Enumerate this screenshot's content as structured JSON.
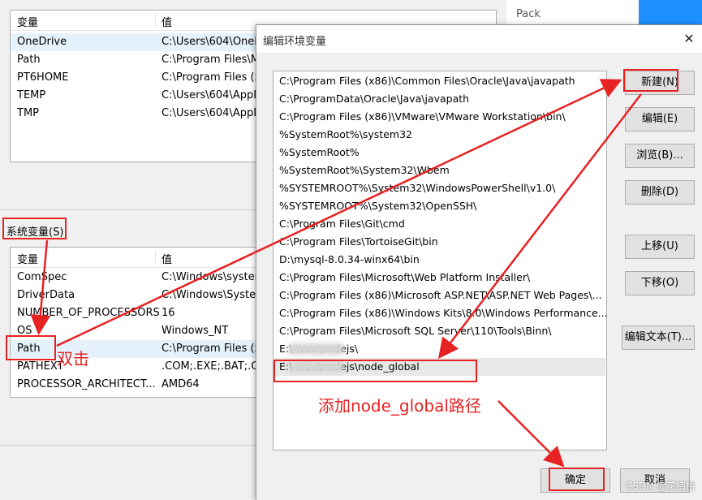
{
  "background_window": {
    "user_vars": {
      "headers": {
        "name": "变量",
        "value": "值"
      },
      "rows": [
        {
          "name": "OneDrive",
          "value": "C:\\Users\\604\\OneD"
        },
        {
          "name": "Path",
          "value": "C:\\Program Files\\M"
        },
        {
          "name": "PT6HOME",
          "value": "C:\\Program Files (x"
        },
        {
          "name": "TEMP",
          "value": "C:\\Users\\604\\AppD"
        },
        {
          "name": "TMP",
          "value": "C:\\Users\\604\\AppD"
        }
      ]
    },
    "system_vars_label": "系统变量(S)",
    "system_vars": {
      "headers": {
        "name": "变量",
        "value": "值"
      },
      "rows": [
        {
          "name": "ComSpec",
          "value": "C:\\Windows\\system"
        },
        {
          "name": "DriverData",
          "value": "C:\\Windows\\Syster"
        },
        {
          "name": "NUMBER_OF_PROCESSORS",
          "value": "16"
        },
        {
          "name": "OS",
          "value": "Windows_NT"
        },
        {
          "name": "Path",
          "value": "C:\\Program Files (x"
        },
        {
          "name": "PATHEXT",
          "value": ".COM;.EXE;.BAT;.CN"
        },
        {
          "name": "PROCESSOR_ARCHITECT...",
          "value": "AMD64"
        }
      ]
    },
    "right_text": "Pack"
  },
  "dialog": {
    "title": "编辑环境变量",
    "close_glyph": "✕",
    "paths": [
      "C:\\Program Files (x86)\\Common Files\\Oracle\\Java\\javapath",
      "C:\\ProgramData\\Oracle\\Java\\javapath",
      "C:\\Program Files (x86)\\VMware\\VMware Workstation\\bin\\",
      "%SystemRoot%\\system32",
      "%SystemRoot%",
      "%SystemRoot%\\System32\\Wbem",
      "%SYSTEMROOT%\\System32\\WindowsPowerShell\\v1.0\\",
      "%SYSTEMROOT%\\System32\\OpenSSH\\",
      "C:\\Program Files\\Git\\cmd",
      "C:\\Program Files\\TortoiseGit\\bin",
      "D:\\mysql-8.0.34-winx64\\bin",
      "C:\\Program Files\\Microsoft\\Web Platform Installer\\",
      "C:\\Program Files (x86)\\Microsoft ASP.NET\\ASP.NET Web Pages\\...",
      "C:\\Program Files (x86)\\Windows Kits\\8.0\\Windows Performance...",
      "C:\\Program Files\\Microsoft SQL Server\\110\\Tools\\Binn\\",
      "E:\\       \\vue\\nodejs\\",
      "E:\\       \\vue\\nodejs\\node_global"
    ],
    "buttons": {
      "new": "新建(N)",
      "edit": "编辑(E)",
      "browse": "浏览(B)...",
      "delete": "删除(D)",
      "move_up": "上移(U)",
      "move_down": "下移(O)",
      "edit_text": "编辑文本(T)...",
      "ok": "确定",
      "cancel": "取消"
    }
  },
  "annotations": {
    "double_click": "双击",
    "add_path": "添加node_global路径",
    "color": "#e62222"
  },
  "watermark": "CSDN @花楠拾"
}
